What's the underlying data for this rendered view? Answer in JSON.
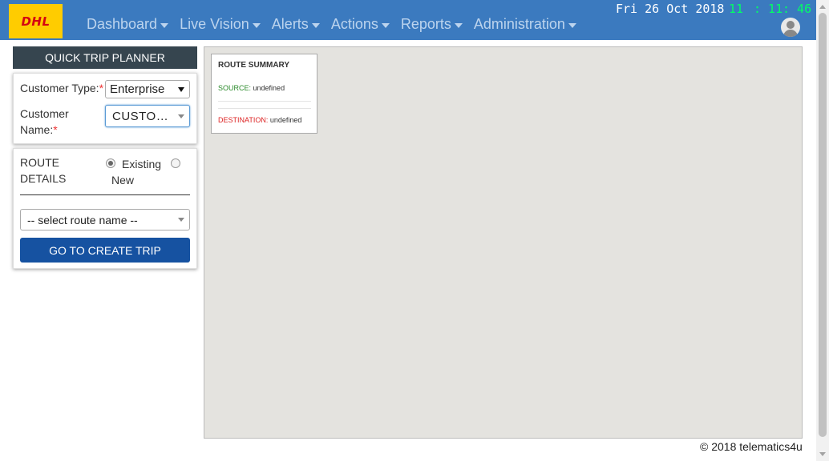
{
  "header": {
    "logo_text": "DHL",
    "nav": [
      {
        "label": "Dashboard"
      },
      {
        "label": "Live Vision"
      },
      {
        "label": "Alerts"
      },
      {
        "label": "Actions"
      },
      {
        "label": "Reports"
      },
      {
        "label": "Administration"
      }
    ],
    "date": "Fri 26 Oct 2018",
    "clock_hour": "11",
    "clock_min": ": 11",
    "clock_sec": ": 46",
    "colors": {
      "bar": "#3b7abf",
      "clock": "#00ff66",
      "logo_bg": "#ffcc00",
      "logo_text": "#d40511"
    },
    "avatar_icon": "user-avatar-icon"
  },
  "planner": {
    "title": "QUICK TRIP PLANNER",
    "customer_type_label": "Customer Type:",
    "customer_type_value": "Enterprise",
    "customer_name_label_1": "Customer",
    "customer_name_label_2": "Name:",
    "customer_name_value": "CUSTOMER",
    "required_mark": "*",
    "route_details_label_1": "ROUTE",
    "route_details_label_2": "DETAILS",
    "radio_existing": "Existing",
    "radio_new": "New",
    "route_select_placeholder": "-- select route name --",
    "create_trip_button": "GO TO CREATE TRIP",
    "button_color": "#1652a1"
  },
  "summary": {
    "title": "ROUTE SUMMARY",
    "source_label": "SOURCE:",
    "source_value": "undefined",
    "destination_label": "DESTINATION:",
    "destination_value": "undefined"
  },
  "footer": {
    "copyright": "© 2018 telematics4u"
  }
}
